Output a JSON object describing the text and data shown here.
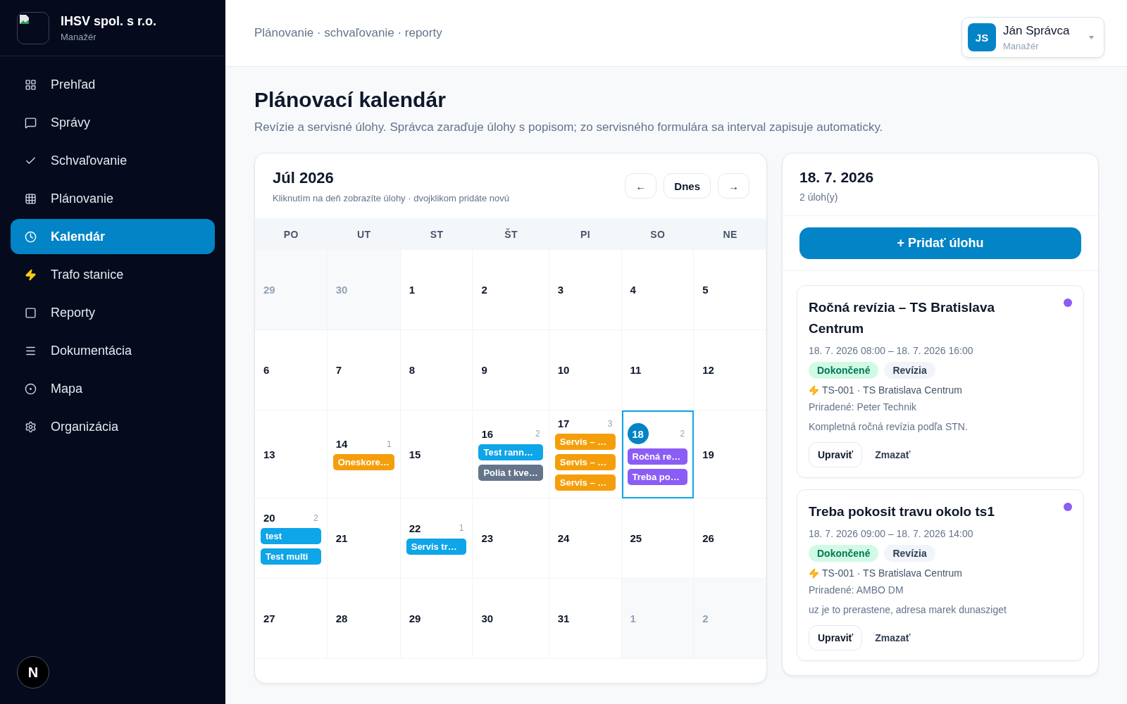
{
  "org": {
    "name": "IHSV spol. s r.o.",
    "role": "Manažér"
  },
  "nav": [
    {
      "label": "Prehľad",
      "selected": false
    },
    {
      "label": "Správy",
      "selected": false
    },
    {
      "label": "Schvaľovanie",
      "selected": false
    },
    {
      "label": "Plánovanie",
      "selected": false
    },
    {
      "label": "Kalendár",
      "selected": true
    },
    {
      "label": "Trafo stanice",
      "selected": false
    },
    {
      "label": "Reporty",
      "selected": false
    },
    {
      "label": "Dokumentácia",
      "selected": false
    },
    {
      "label": "Mapa",
      "selected": false
    },
    {
      "label": "Organizácia",
      "selected": false
    }
  ],
  "dev_badge": "N",
  "breadcrumb": "Plánovanie · schvaľovanie · reporty",
  "user": {
    "initials": "JS",
    "name": "Ján Správca",
    "role": "Manažér"
  },
  "page": {
    "title": "Plánovací kalendár",
    "subtitle": "Revízie a servisné úlohy. Správca zaraďuje úlohy s popisom; zo servisného formulára sa interval zapisuje automaticky."
  },
  "calendar": {
    "title": "Júl 2026",
    "hint": "Kliknutím na deň zobrazíte úlohy · dvojklikom pridáte novú",
    "prev": "←",
    "today": "Dnes",
    "next": "→",
    "weekdays": [
      "PO",
      "UT",
      "ST",
      "ŠT",
      "PI",
      "SO",
      "NE"
    ],
    "weeks": [
      [
        {
          "day": "29",
          "outside": true,
          "selected": false
        },
        {
          "day": "30",
          "outside": true,
          "selected": false
        },
        {
          "day": "1",
          "outside": false,
          "selected": false
        },
        {
          "day": "2",
          "outside": false,
          "selected": false
        },
        {
          "day": "3",
          "outside": false,
          "selected": false
        },
        {
          "day": "4",
          "outside": false,
          "selected": false
        },
        {
          "day": "5",
          "outside": false,
          "selected": false
        }
      ],
      [
        {
          "day": "6",
          "outside": false,
          "selected": false
        },
        {
          "day": "7",
          "outside": false,
          "selected": false
        },
        {
          "day": "8",
          "outside": false,
          "selected": false
        },
        {
          "day": "9",
          "outside": false,
          "selected": false
        },
        {
          "day": "10",
          "outside": false,
          "selected": false
        },
        {
          "day": "11",
          "outside": false,
          "selected": false
        },
        {
          "day": "12",
          "outside": false,
          "selected": false
        }
      ],
      [
        {
          "day": "13",
          "outside": false,
          "selected": false
        },
        {
          "day": "14",
          "outside": false,
          "selected": false,
          "count": "1",
          "events": [
            {
              "label": "Oneskore…",
              "color": "#f59e0b"
            }
          ]
        },
        {
          "day": "15",
          "outside": false,
          "selected": false
        },
        {
          "day": "16",
          "outside": false,
          "selected": false,
          "count": "2",
          "events": [
            {
              "label": "Test rann…",
              "color": "#0ea5e9"
            },
            {
              "label": "Polia t kve…",
              "color": "#64748b"
            }
          ]
        },
        {
          "day": "17",
          "outside": false,
          "selected": false,
          "count": "3",
          "events": [
            {
              "label": "Servis – …",
              "color": "#f59e0b"
            },
            {
              "label": "Servis – …",
              "color": "#f59e0b"
            },
            {
              "label": "Servis – …",
              "color": "#f59e0b"
            }
          ]
        },
        {
          "day": "18",
          "outside": false,
          "selected": true,
          "count": "2",
          "events": [
            {
              "label": "Ročná re…",
              "color": "#8b5cf6"
            },
            {
              "label": "Treba po…",
              "color": "#8b5cf6"
            }
          ]
        },
        {
          "day": "19",
          "outside": false,
          "selected": false
        }
      ],
      [
        {
          "day": "20",
          "outside": false,
          "selected": false,
          "count": "2",
          "events": [
            {
              "label": "test",
              "color": "#0ea5e9"
            },
            {
              "label": "Test multi",
              "color": "#0ea5e9"
            }
          ]
        },
        {
          "day": "21",
          "outside": false,
          "selected": false
        },
        {
          "day": "22",
          "outside": false,
          "selected": false,
          "count": "1",
          "events": [
            {
              "label": "Servis tr…",
              "color": "#0ea5e9"
            }
          ]
        },
        {
          "day": "23",
          "outside": false,
          "selected": false
        },
        {
          "day": "24",
          "outside": false,
          "selected": false
        },
        {
          "day": "25",
          "outside": false,
          "selected": false
        },
        {
          "day": "26",
          "outside": false,
          "selected": false
        }
      ],
      [
        {
          "day": "27",
          "outside": false,
          "selected": false
        },
        {
          "day": "28",
          "outside": false,
          "selected": false
        },
        {
          "day": "29",
          "outside": false,
          "selected": false
        },
        {
          "day": "30",
          "outside": false,
          "selected": false
        },
        {
          "day": "31",
          "outside": false,
          "selected": false
        },
        {
          "day": "1",
          "outside": true,
          "selected": false
        },
        {
          "day": "2",
          "outside": true,
          "selected": false
        }
      ]
    ]
  },
  "day_panel": {
    "date": "18. 7. 2026",
    "count": "2 úloh(y)",
    "add_button": "+ Pridať úlohu",
    "tasks": [
      {
        "title": "Ročná revízia – TS Bratislava Centrum",
        "color": "#8b5cf6",
        "time": "18. 7. 2026 08:00 – 18. 7. 2026 16:00",
        "status": "Dokončené",
        "type": "Revízia",
        "station": "TS-001 · TS Bratislava Centrum",
        "assigned": "Priradené: Peter Technik",
        "description": "Kompletná ročná revízia podľa STN.",
        "edit": "Upraviť",
        "delete": "Zmazať"
      },
      {
        "title": "Treba pokosit travu okolo ts1",
        "color": "#8b5cf6",
        "time": "18. 7. 2026 09:00 – 18. 7. 2026 14:00",
        "status": "Dokončené",
        "type": "Revízia",
        "station": "TS-001 · TS Bratislava Centrum",
        "assigned": "Priradené: AMBO DM",
        "description": "uz je to prerastene, adresa marek dunasziget",
        "edit": "Upraviť",
        "delete": "Zmazať"
      }
    ]
  }
}
